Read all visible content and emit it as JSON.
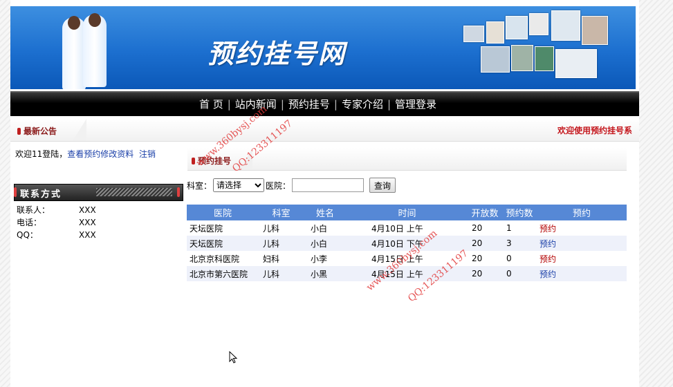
{
  "header": {
    "site_title": "预约挂号网"
  },
  "nav": {
    "items": [
      "首 页",
      "站内新闻",
      "预约挂号",
      "专家介绍",
      "管理登录"
    ]
  },
  "notice": {
    "label": "最新公告",
    "marquee": "欢迎使用预约挂号系"
  },
  "welcome": {
    "prefix": "欢迎11登陆，",
    "view_link": "查看预约",
    "edit_link": "修改资料",
    "logout_link": "注销"
  },
  "contact": {
    "title": "联系方式",
    "rows": [
      {
        "key": "联系人：",
        "value": "XXX"
      },
      {
        "key": "电话：",
        "value": "XXX"
      },
      {
        "key": "QQ：",
        "value": "XXX"
      }
    ]
  },
  "panel": {
    "title": "预约挂号"
  },
  "search": {
    "dept_label": "科室：",
    "dept_selected": "请选择",
    "hospital_label": "医院：",
    "hospital_value": "",
    "button": "查询"
  },
  "table": {
    "headers": [
      "医院",
      "科室",
      "姓名",
      "时间",
      "开放数",
      "预约数",
      "预约"
    ],
    "rows": [
      [
        "天坛医院",
        "儿科",
        "小白",
        "4月10日 上午",
        "20",
        "1",
        "预约"
      ],
      [
        "天坛医院",
        "儿科",
        "小白",
        "4月10日 下午",
        "20",
        "3",
        "预约"
      ],
      [
        "北京京科医院",
        "妇科",
        "小李",
        "4月15日 上午",
        "20",
        "0",
        "预约"
      ],
      [
        "北京市第六医院",
        "儿科",
        "小黑",
        "4月15日 上午",
        "20",
        "0",
        "预约"
      ]
    ]
  },
  "watermark": {
    "line1": "www.360bysj.com",
    "line2": "QQ:123311197"
  },
  "colors": {
    "header_blue": "#1c6fcf",
    "table_header": "#5688d6",
    "link_blue": "#1a3fa8",
    "link_red": "#b30000"
  }
}
